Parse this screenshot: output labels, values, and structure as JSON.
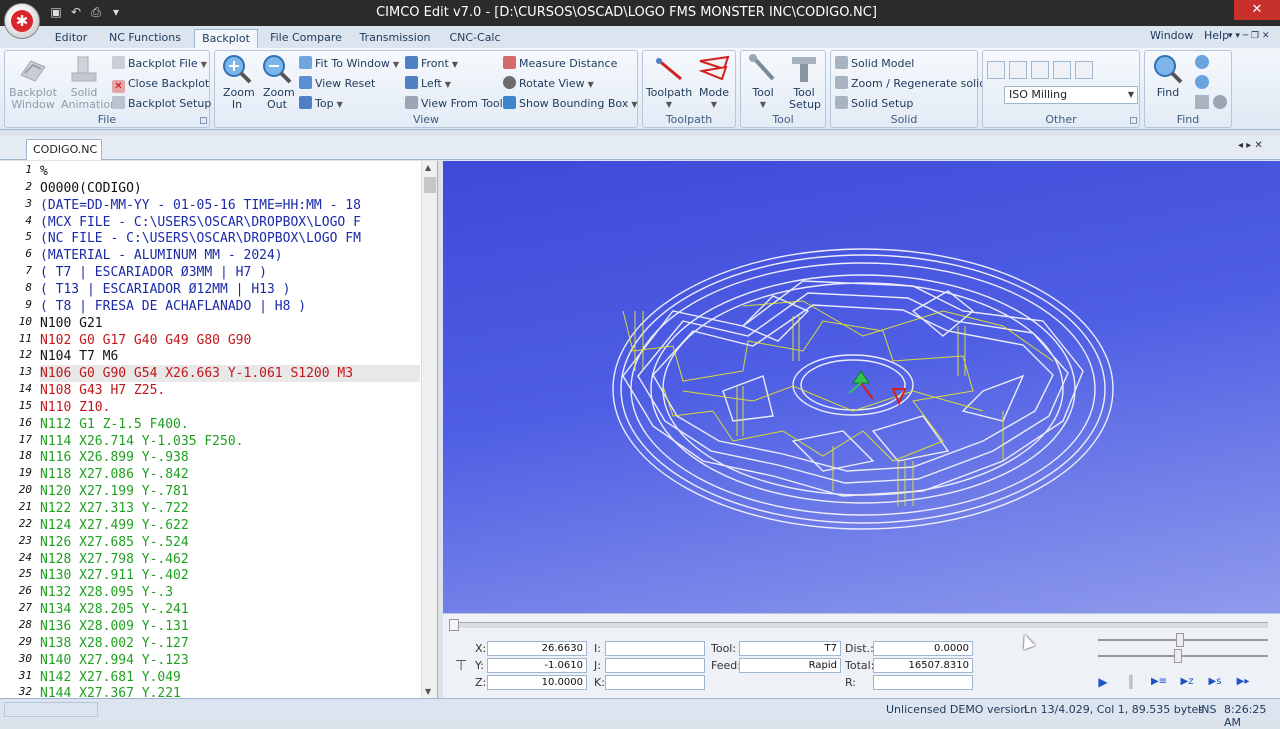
{
  "app": {
    "logo_letter": "✱",
    "title": "CIMCO Edit v7.0 - [D:\\CURSOS\\OSCAD\\LOGO FMS MONSTER INC\\CODIGO.NC]",
    "close_glyph": "✕"
  },
  "quick_access": [
    {
      "icon": "save-icon",
      "glyph": "▣"
    },
    {
      "icon": "undo-icon",
      "glyph": "↶"
    },
    {
      "icon": "print-icon",
      "glyph": "⎙"
    },
    {
      "icon": "customize-icon",
      "glyph": "▾"
    }
  ],
  "ribbon_tabs": [
    "Editor",
    "NC Functions",
    "Backplot",
    "File Compare",
    "Transmission",
    "CNC-Calc"
  ],
  "active_tab": "Backplot",
  "window_menu": {
    "window": "Window",
    "help": "Help",
    "extras": "▾  ▾   ─ ❐ ✕"
  },
  "ribbon": {
    "file": {
      "label": "File",
      "backplot_window": "Backplot Window",
      "solid_animation": "Solid Animation",
      "backplot_file": "Backplot File",
      "close_backplot": "Close Backplot",
      "backplot_setup": "Backplot Setup"
    },
    "view": {
      "label": "View",
      "zoom_in": "Zoom In",
      "zoom_out": "Zoom Out",
      "fit_to_window": "Fit To Window",
      "view_reset": "View Reset",
      "top": "Top",
      "front": "Front",
      "left": "Left",
      "view_from_tool": "View From Tool",
      "measure_distance": "Measure Distance",
      "rotate_view": "Rotate View",
      "show_bounding_box": "Show Bounding Box"
    },
    "toolpath": {
      "label": "Toolpath",
      "toolpath": "Toolpath",
      "mode": "Mode"
    },
    "tool": {
      "label": "Tool",
      "tool": "Tool",
      "tool_setup": "Tool Setup"
    },
    "solid": {
      "label": "Solid",
      "solid_model": "Solid Model",
      "zoom_regenerate": "Zoom / Regenerate solid",
      "solid_setup": "Solid Setup"
    },
    "other": {
      "label": "Other",
      "machine_type": "ISO Milling"
    },
    "find": {
      "label": "Find",
      "find": "Find"
    }
  },
  "document_tab": "CODIGO.NC",
  "doc_nav": "◂ ▸ ✕",
  "code_lines": [
    {
      "n": "1",
      "text": "%",
      "color": "#111111"
    },
    {
      "n": "2",
      "text": "O0000(CODIGO)",
      "color": "#111111"
    },
    {
      "n": "3",
      "text": "(DATE=DD-MM-YY - 01-05-16 TIME=HH:MM - 18",
      "color": "#1a2aa8"
    },
    {
      "n": "4",
      "text": "(MCX FILE - C:\\USERS\\OSCAR\\DROPBOX\\LOGO F",
      "color": "#1a2aa8"
    },
    {
      "n": "5",
      "text": "(NC FILE - C:\\USERS\\OSCAR\\DROPBOX\\LOGO FM",
      "color": "#1a2aa8"
    },
    {
      "n": "6",
      "text": "(MATERIAL - ALUMINUM MM - 2024)",
      "color": "#1a2aa8"
    },
    {
      "n": "7",
      "text": "( T7 | ESCARIADOR Ø3MM | H7 )",
      "color": "#1a2aa8"
    },
    {
      "n": "8",
      "text": "( T13 | ESCARIADOR Ø12MM | H13 )",
      "color": "#1a2aa8"
    },
    {
      "n": "9",
      "text": "( T8 | FRESA DE ACHAFLANADO | H8 )",
      "color": "#1a2aa8"
    },
    {
      "n": "10",
      "text": "N100 G21",
      "color": "#111111"
    },
    {
      "n": "11",
      "text": "N102 G0 G17 G40 G49 G80 G90",
      "color": "#c0171b"
    },
    {
      "n": "12",
      "text": "N104 T7 M6",
      "color": "#111111"
    },
    {
      "n": "13",
      "text": "N106 G0 G90 G54 X26.663 Y-1.061 S1200 M3",
      "color": "#c0171b",
      "highlight": true
    },
    {
      "n": "14",
      "text": "N108 G43 H7 Z25.",
      "color": "#c0171b"
    },
    {
      "n": "15",
      "text": "N110 Z10.",
      "color": "#c0171b"
    },
    {
      "n": "16",
      "text": "N112 G1 Z-1.5 F400.",
      "color": "#20a020"
    },
    {
      "n": "17",
      "text": "N114 X26.714 Y-1.035 F250.",
      "color": "#20a020"
    },
    {
      "n": "18",
      "text": "N116 X26.899 Y-.938",
      "color": "#20a020"
    },
    {
      "n": "19",
      "text": "N118 X27.086 Y-.842",
      "color": "#20a020"
    },
    {
      "n": "20",
      "text": "N120 X27.199 Y-.781",
      "color": "#20a020"
    },
    {
      "n": "21",
      "text": "N122 X27.313 Y-.722",
      "color": "#20a020"
    },
    {
      "n": "22",
      "text": "N124 X27.499 Y-.622",
      "color": "#20a020"
    },
    {
      "n": "23",
      "text": "N126 X27.685 Y-.524",
      "color": "#20a020"
    },
    {
      "n": "24",
      "text": "N128 X27.798 Y-.462",
      "color": "#20a020"
    },
    {
      "n": "25",
      "text": "N130 X27.911 Y-.402",
      "color": "#20a020"
    },
    {
      "n": "26",
      "text": "N132 X28.095 Y-.3",
      "color": "#20a020"
    },
    {
      "n": "27",
      "text": "N134 X28.205 Y-.241",
      "color": "#20a020"
    },
    {
      "n": "28",
      "text": "N136 X28.009 Y-.131",
      "color": "#20a020"
    },
    {
      "n": "29",
      "text": "N138 X28.002 Y-.127",
      "color": "#20a020"
    },
    {
      "n": "30",
      "text": "N140 X27.994 Y-.123",
      "color": "#20a020"
    },
    {
      "n": "31",
      "text": "N142 X27.681 Y.049",
      "color": "#20a020"
    },
    {
      "n": "32",
      "text": "N144 X27.367 Y.221",
      "color": "#20a020"
    }
  ],
  "sim": {
    "x_label": "X:",
    "x_value": "26.6630",
    "y_label": "Y:",
    "y_value": "-1.0610",
    "z_label": "Z:",
    "z_value": "10.0000",
    "i_label": "I:",
    "i_value": "",
    "j_label": "J:",
    "j_value": "",
    "k_label": "K:",
    "k_value": "",
    "tool_label": "Tool:",
    "tool_value": "T7",
    "feed_label": "Feed:",
    "feed_value": "Rapid",
    "dist_label": "Dist.:",
    "dist_value": "0.0000",
    "total_label": "Total:",
    "total_value": "16507.8310",
    "r_label": "R:",
    "r_value": "",
    "speed_level": 0.48,
    "zoom_level": 0.47,
    "buttons": [
      "▶",
      "║",
      "▶≡",
      "▶z",
      "▶s",
      "▶▸"
    ]
  },
  "status": {
    "license": "Unlicensed DEMO version",
    "position": "Ln 13/4.029, Col 1, 89.535 bytes",
    "mode": "INS",
    "time": "8:26:25 AM"
  }
}
